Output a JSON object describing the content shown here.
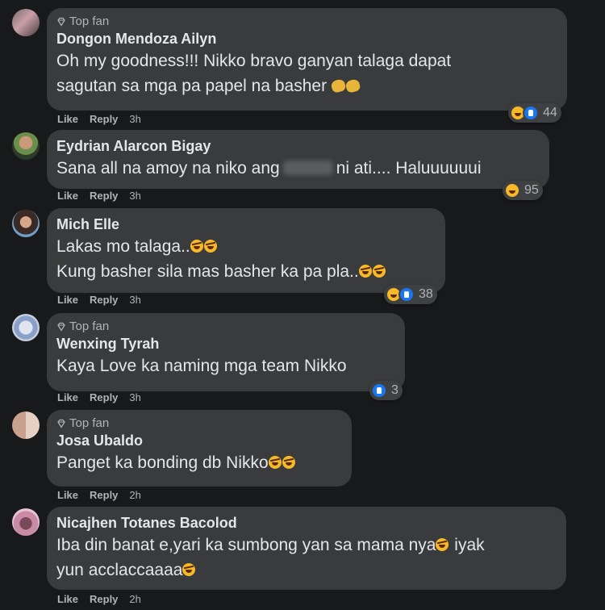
{
  "comments": [
    {
      "top_fan": true,
      "author": "Dongon Mendoza Ailyn",
      "lines": [
        "Oh my goodness!!! Nikko bravo ganyan talaga dapat",
        "sagutan sa mga pa papel na basher"
      ],
      "like": "Like",
      "reply": "Reply",
      "time": "3h",
      "reaction_count": "44",
      "reactions": [
        "haha",
        "like"
      ]
    },
    {
      "top_fan": false,
      "author": "Eydrian Alarcon Bigay",
      "line_before": "Sana all na amoy na niko ang",
      "line_after": "ni ati.... Haluuuuuui",
      "like": "Like",
      "reply": "Reply",
      "time": "3h",
      "reaction_count": "95",
      "reactions": [
        "haha"
      ]
    },
    {
      "top_fan": false,
      "author": "Mich Elle",
      "lines": [
        "Lakas mo talaga..",
        "Kung basher sila mas basher ka pa pla.."
      ],
      "like": "Like",
      "reply": "Reply",
      "time": "3h",
      "reaction_count": "38",
      "reactions": [
        "haha",
        "like"
      ]
    },
    {
      "top_fan": true,
      "author": "Wenxing Tyrah",
      "lines": [
        "Kaya Love ka naming mga team Nikko"
      ],
      "like": "Like",
      "reply": "Reply",
      "time": "3h",
      "reaction_count": "3",
      "reactions": [
        "like"
      ]
    },
    {
      "top_fan": true,
      "author": "Josa Ubaldo",
      "lines": [
        "Panget ka bonding db Nikko"
      ],
      "like": "Like",
      "reply": "Reply",
      "time": "2h"
    },
    {
      "top_fan": false,
      "author": "Nicajhen Totanes Bacolod",
      "lines": [
        "Iba din banat e,yari ka sumbong yan sa mama nya",
        "iyak",
        "yun acclaccaaaa"
      ],
      "like": "Like",
      "reply": "Reply",
      "time": "2h"
    }
  ],
  "top_fan_label": "Top fan",
  "colors": {
    "background": "#18191a",
    "bubble": "#3a3b3c",
    "text": "#e4e6eb",
    "secondary": "#b0b3b8",
    "like_blue": "#1877f2",
    "haha_yellow": "#f7b928"
  },
  "icons": [
    "diamond-icon",
    "haha-reaction-icon",
    "like-reaction-icon",
    "clap-emoji-icon",
    "laughing-emoji-icon"
  ]
}
